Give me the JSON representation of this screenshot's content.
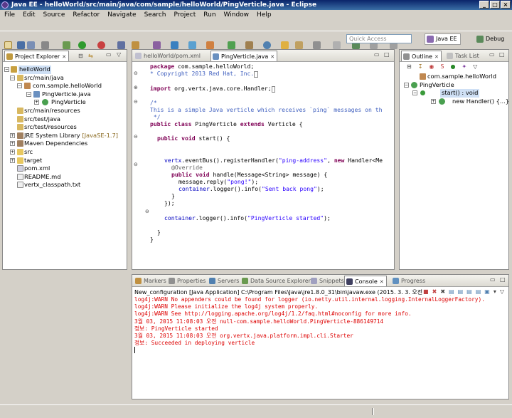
{
  "window": {
    "title": "Java EE - helloWorld/src/main/java/com/sample/helloWorld/PingVerticle.java - Eclipse"
  },
  "menu": [
    "File",
    "Edit",
    "Source",
    "Refactor",
    "Navigate",
    "Search",
    "Project",
    "Run",
    "Window",
    "Help"
  ],
  "quick_access": {
    "placeholder": "Quick Access"
  },
  "perspectives": {
    "java_ee": "Java EE",
    "debug": "Debug"
  },
  "project_explorer": {
    "tab": "Project Explorer",
    "items": [
      "helloWorld",
      "src/main/java",
      "com.sample.helloWorld",
      "PingVerticle.java",
      "PingVerticle",
      "src/main/resources",
      "src/test/java",
      "src/test/resources",
      "JRE System Library",
      "[JavaSE-1.7]",
      "Maven Dependencies",
      "src",
      "target",
      "pom.xml",
      "README.md",
      "vertx_classpath.txt"
    ]
  },
  "editor": {
    "tabs": [
      "helloWorld/pom.xml",
      "PingVerticle.java"
    ],
    "lines": {
      "l1a": "package",
      "l1b": " com.sample.helloWorld;",
      "l2": "* Copyright 2013 Red Hat, Inc.",
      "l3a": "import",
      "l3b": " org.vertx.java.core.Handler;",
      "l4": "/*",
      "l5": "This is a simple Java verticle which receives `ping` messages on th",
      "l6": " */",
      "l7a": "public class",
      "l7b": " PingVerticle ",
      "l7c": "extends",
      "l7d": " Verticle {",
      "l8a": "public void",
      "l8b": " start() {",
      "l9a": "vertx",
      "l9b": ".eventBus().registerHandler(",
      "l9c": "\"ping-address\"",
      "l9d": ", ",
      "l9e": "new",
      "l9f": " Handler<Me",
      "l10": "@Override",
      "l11a": "public void",
      "l11b": " handle(Message<String> message) {",
      "l12a": "message.reply(",
      "l12b": "\"pong!\"",
      "l12c": ");",
      "l13a": "container",
      "l13b": ".logger().info(",
      "l13c": "\"Sent back pong\"",
      "l13d": ");",
      "l14": "}",
      "l15": "});",
      "l16a": "container",
      "l16b": ".logger().info(",
      "l16c": "\"PingVerticle started\"",
      "l16d": ");",
      "l17": "}",
      "l18": "}"
    }
  },
  "outline": {
    "tabs": [
      "Outline",
      "Task List"
    ],
    "items": [
      "com.sample.helloWorld",
      "PingVerticle",
      "start() : void",
      "new Handler() {...}"
    ]
  },
  "bottom": {
    "tabs": [
      "Markers",
      "Properties",
      "Servers",
      "Data Source Explorer",
      "Snippets",
      "Console",
      "Progress"
    ],
    "console_header": "New_configuration [Java Application] C:\\Program Files\\Java\\jre1.8.0_31\\bin\\javaw.exe (2015. 3. 3. 오전 11:08:02)",
    "output": [
      "log4j:WARN No appenders could be found for logger (io.netty.util.internal.logging.InternalLoggerFactory).",
      "log4j:WARN Please initialize the log4j system properly.",
      "log4j:WARN See http://logging.apache.org/log4j/1.2/faq.html#noconfig for more info.",
      "3월 03, 2015 11:08:03 오전 null-com.sample.helloWorld.PingVerticle-886149714",
      "정보: PingVerticle started",
      "3월 03, 2015 11:08:03 오전 org.vertx.java.platform.impl.cli.Starter",
      "정보: Succeeded in deploying verticle"
    ]
  },
  "colors": {
    "keyword": "#7f0055",
    "comment": "#3f5fbf",
    "string": "#2a00ff",
    "console_error": "#dd0000",
    "titlebar": "#0a246a"
  }
}
